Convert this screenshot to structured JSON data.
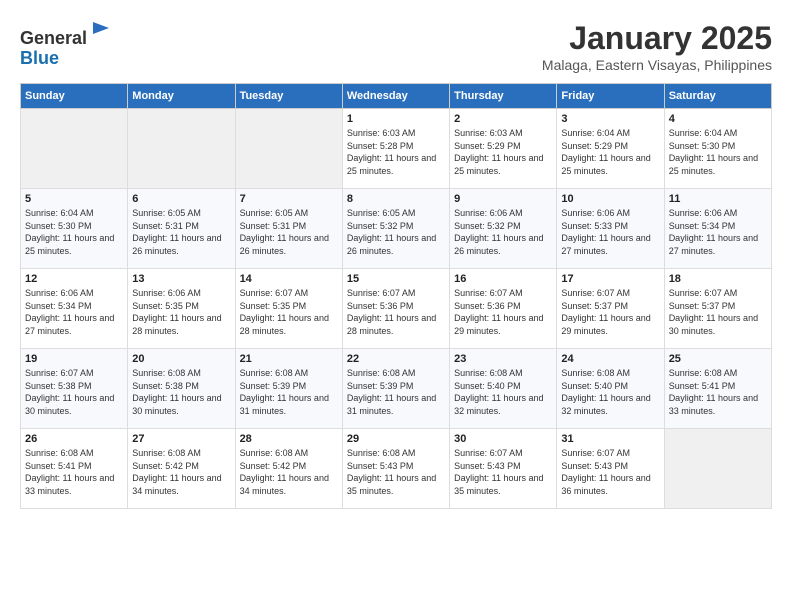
{
  "logo": {
    "general": "General",
    "blue": "Blue"
  },
  "title": "January 2025",
  "location": "Malaga, Eastern Visayas, Philippines",
  "days_of_week": [
    "Sunday",
    "Monday",
    "Tuesday",
    "Wednesday",
    "Thursday",
    "Friday",
    "Saturday"
  ],
  "weeks": [
    [
      {
        "day": "",
        "sunrise": "",
        "sunset": "",
        "daylight": ""
      },
      {
        "day": "",
        "sunrise": "",
        "sunset": "",
        "daylight": ""
      },
      {
        "day": "",
        "sunrise": "",
        "sunset": "",
        "daylight": ""
      },
      {
        "day": "1",
        "sunrise": "Sunrise: 6:03 AM",
        "sunset": "Sunset: 5:28 PM",
        "daylight": "Daylight: 11 hours and 25 minutes."
      },
      {
        "day": "2",
        "sunrise": "Sunrise: 6:03 AM",
        "sunset": "Sunset: 5:29 PM",
        "daylight": "Daylight: 11 hours and 25 minutes."
      },
      {
        "day": "3",
        "sunrise": "Sunrise: 6:04 AM",
        "sunset": "Sunset: 5:29 PM",
        "daylight": "Daylight: 11 hours and 25 minutes."
      },
      {
        "day": "4",
        "sunrise": "Sunrise: 6:04 AM",
        "sunset": "Sunset: 5:30 PM",
        "daylight": "Daylight: 11 hours and 25 minutes."
      }
    ],
    [
      {
        "day": "5",
        "sunrise": "Sunrise: 6:04 AM",
        "sunset": "Sunset: 5:30 PM",
        "daylight": "Daylight: 11 hours and 25 minutes."
      },
      {
        "day": "6",
        "sunrise": "Sunrise: 6:05 AM",
        "sunset": "Sunset: 5:31 PM",
        "daylight": "Daylight: 11 hours and 26 minutes."
      },
      {
        "day": "7",
        "sunrise": "Sunrise: 6:05 AM",
        "sunset": "Sunset: 5:31 PM",
        "daylight": "Daylight: 11 hours and 26 minutes."
      },
      {
        "day": "8",
        "sunrise": "Sunrise: 6:05 AM",
        "sunset": "Sunset: 5:32 PM",
        "daylight": "Daylight: 11 hours and 26 minutes."
      },
      {
        "day": "9",
        "sunrise": "Sunrise: 6:06 AM",
        "sunset": "Sunset: 5:32 PM",
        "daylight": "Daylight: 11 hours and 26 minutes."
      },
      {
        "day": "10",
        "sunrise": "Sunrise: 6:06 AM",
        "sunset": "Sunset: 5:33 PM",
        "daylight": "Daylight: 11 hours and 27 minutes."
      },
      {
        "day": "11",
        "sunrise": "Sunrise: 6:06 AM",
        "sunset": "Sunset: 5:34 PM",
        "daylight": "Daylight: 11 hours and 27 minutes."
      }
    ],
    [
      {
        "day": "12",
        "sunrise": "Sunrise: 6:06 AM",
        "sunset": "Sunset: 5:34 PM",
        "daylight": "Daylight: 11 hours and 27 minutes."
      },
      {
        "day": "13",
        "sunrise": "Sunrise: 6:06 AM",
        "sunset": "Sunset: 5:35 PM",
        "daylight": "Daylight: 11 hours and 28 minutes."
      },
      {
        "day": "14",
        "sunrise": "Sunrise: 6:07 AM",
        "sunset": "Sunset: 5:35 PM",
        "daylight": "Daylight: 11 hours and 28 minutes."
      },
      {
        "day": "15",
        "sunrise": "Sunrise: 6:07 AM",
        "sunset": "Sunset: 5:36 PM",
        "daylight": "Daylight: 11 hours and 28 minutes."
      },
      {
        "day": "16",
        "sunrise": "Sunrise: 6:07 AM",
        "sunset": "Sunset: 5:36 PM",
        "daylight": "Daylight: 11 hours and 29 minutes."
      },
      {
        "day": "17",
        "sunrise": "Sunrise: 6:07 AM",
        "sunset": "Sunset: 5:37 PM",
        "daylight": "Daylight: 11 hours and 29 minutes."
      },
      {
        "day": "18",
        "sunrise": "Sunrise: 6:07 AM",
        "sunset": "Sunset: 5:37 PM",
        "daylight": "Daylight: 11 hours and 30 minutes."
      }
    ],
    [
      {
        "day": "19",
        "sunrise": "Sunrise: 6:07 AM",
        "sunset": "Sunset: 5:38 PM",
        "daylight": "Daylight: 11 hours and 30 minutes."
      },
      {
        "day": "20",
        "sunrise": "Sunrise: 6:08 AM",
        "sunset": "Sunset: 5:38 PM",
        "daylight": "Daylight: 11 hours and 30 minutes."
      },
      {
        "day": "21",
        "sunrise": "Sunrise: 6:08 AM",
        "sunset": "Sunset: 5:39 PM",
        "daylight": "Daylight: 11 hours and 31 minutes."
      },
      {
        "day": "22",
        "sunrise": "Sunrise: 6:08 AM",
        "sunset": "Sunset: 5:39 PM",
        "daylight": "Daylight: 11 hours and 31 minutes."
      },
      {
        "day": "23",
        "sunrise": "Sunrise: 6:08 AM",
        "sunset": "Sunset: 5:40 PM",
        "daylight": "Daylight: 11 hours and 32 minutes."
      },
      {
        "day": "24",
        "sunrise": "Sunrise: 6:08 AM",
        "sunset": "Sunset: 5:40 PM",
        "daylight": "Daylight: 11 hours and 32 minutes."
      },
      {
        "day": "25",
        "sunrise": "Sunrise: 6:08 AM",
        "sunset": "Sunset: 5:41 PM",
        "daylight": "Daylight: 11 hours and 33 minutes."
      }
    ],
    [
      {
        "day": "26",
        "sunrise": "Sunrise: 6:08 AM",
        "sunset": "Sunset: 5:41 PM",
        "daylight": "Daylight: 11 hours and 33 minutes."
      },
      {
        "day": "27",
        "sunrise": "Sunrise: 6:08 AM",
        "sunset": "Sunset: 5:42 PM",
        "daylight": "Daylight: 11 hours and 34 minutes."
      },
      {
        "day": "28",
        "sunrise": "Sunrise: 6:08 AM",
        "sunset": "Sunset: 5:42 PM",
        "daylight": "Daylight: 11 hours and 34 minutes."
      },
      {
        "day": "29",
        "sunrise": "Sunrise: 6:08 AM",
        "sunset": "Sunset: 5:43 PM",
        "daylight": "Daylight: 11 hours and 35 minutes."
      },
      {
        "day": "30",
        "sunrise": "Sunrise: 6:07 AM",
        "sunset": "Sunset: 5:43 PM",
        "daylight": "Daylight: 11 hours and 35 minutes."
      },
      {
        "day": "31",
        "sunrise": "Sunrise: 6:07 AM",
        "sunset": "Sunset: 5:43 PM",
        "daylight": "Daylight: 11 hours and 36 minutes."
      },
      {
        "day": "",
        "sunrise": "",
        "sunset": "",
        "daylight": ""
      }
    ]
  ]
}
